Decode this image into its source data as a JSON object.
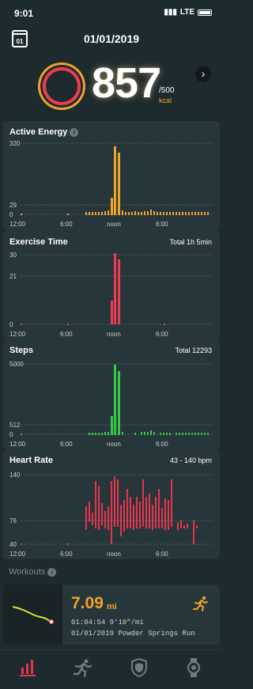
{
  "status": {
    "time": "9:01",
    "network": "LTE"
  },
  "header": {
    "date": "01/01/2019",
    "calendar_day": "01"
  },
  "summary": {
    "value": "857",
    "goal": "/500",
    "unit": "kcal"
  },
  "cards": {
    "active_energy": {
      "title": "Active Energy",
      "y_ticks": [
        "320",
        "29",
        "0"
      ],
      "x_ticks": [
        "12:00",
        "6:00",
        "noon",
        "6:00"
      ]
    },
    "exercise_time": {
      "title": "Exercise Time",
      "info": "Total  1h 5min",
      "y_ticks": [
        "30",
        "21",
        "0"
      ],
      "x_ticks": [
        "12:00",
        "6:00",
        "noon",
        "6:00"
      ]
    },
    "steps": {
      "title": "Steps",
      "info": "Total  12293",
      "y_ticks": [
        "5000",
        "512",
        "0"
      ],
      "x_ticks": [
        "12:00",
        "6:00",
        "noon",
        "6:00"
      ]
    },
    "heart_rate": {
      "title": "Heart Rate",
      "info": "43 - 140 bpm",
      "y_ticks": [
        "140",
        "76",
        "40"
      ],
      "x_ticks": [
        "12:00",
        "6:00",
        "noon",
        "6:00"
      ]
    }
  },
  "workouts": {
    "label": "Workouts",
    "items": [
      {
        "distance": "7.09",
        "distance_unit": "mi",
        "duration": "01:04:54",
        "pace": "9'10\"/mi",
        "title": "01/01/2019 Powder Springs Run"
      }
    ]
  },
  "tabs": [
    "summary-tab",
    "workouts-tab",
    "achievements-tab",
    "device-tab"
  ],
  "colors": {
    "energy": "#f0a32a",
    "exercise": "#ef3b52",
    "steps": "#35c746",
    "heart": "#e8344a",
    "background": "#1d2a2e",
    "card": "#27363b"
  }
}
